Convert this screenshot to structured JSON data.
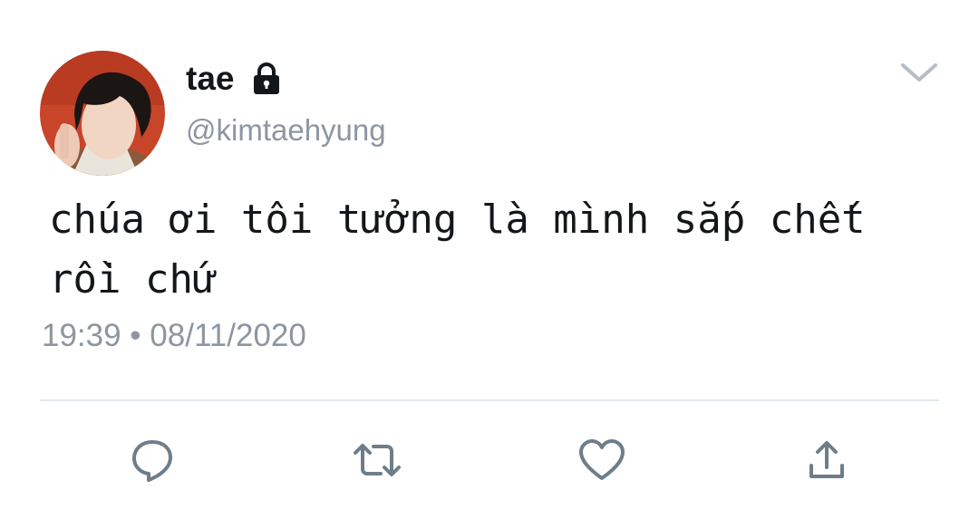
{
  "tweet": {
    "display_name": "tae",
    "handle": "@kimtaehyung",
    "text": "chúa ơi tôi tưởng là mình sắp chết\nrồi chứ",
    "timestamp": "19:39 • 08/11/2020"
  },
  "icons": {
    "lock": "lock-icon",
    "chevron": "chevron-down-icon",
    "reply": "reply-icon",
    "retweet": "retweet-icon",
    "like": "heart-icon",
    "share": "share-icon"
  },
  "colors": {
    "text_primary": "#14171a",
    "text_secondary": "#8d96a0",
    "icon_gray": "#6e7d8a",
    "divider": "#e1e8ed"
  }
}
